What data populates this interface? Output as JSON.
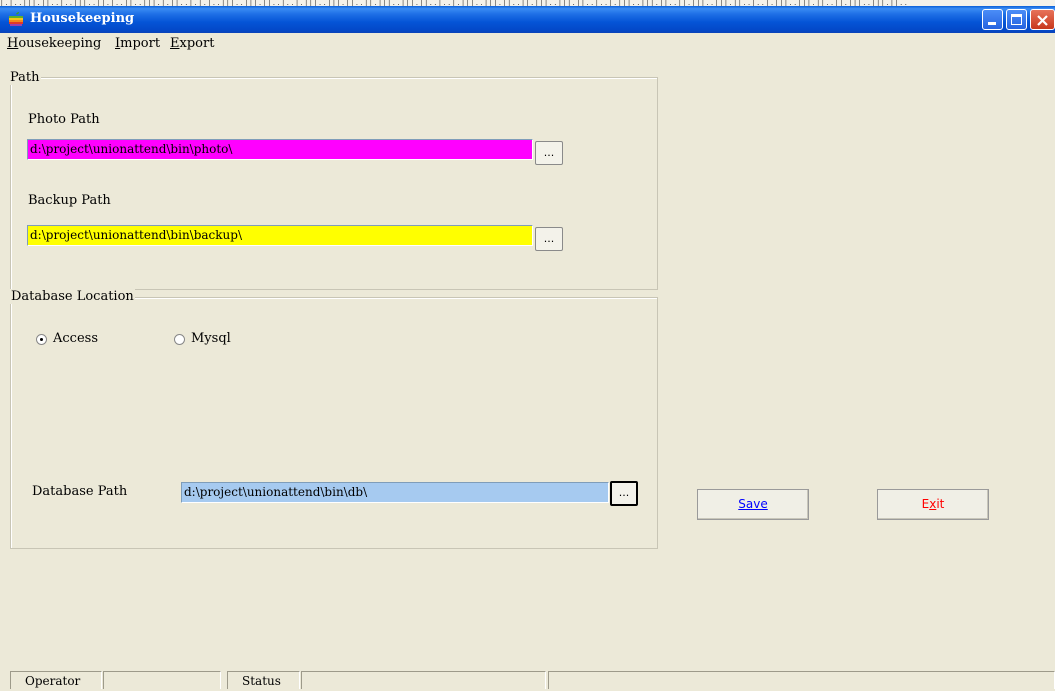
{
  "window": {
    "title": "Housekeeping"
  },
  "menu": [
    {
      "label": "Housekeeping"
    },
    {
      "label": "Import"
    },
    {
      "label": "Export"
    }
  ],
  "path_group": {
    "legend": "Path",
    "photo_label": "Photo Path",
    "photo_value": "d:\\project\\unionattend\\bin\\photo\\",
    "backup_label": "Backup Path",
    "backup_value": "d:\\project\\unionattend\\bin\\backup\\",
    "browse_label": "..."
  },
  "db_group": {
    "legend": "Database Location",
    "radio_access": "Access",
    "radio_mysql": "Mysql",
    "selected": "Access",
    "db_path_label": "Database Path",
    "db_path_value": "d:\\project\\unionattend\\bin\\db\\",
    "browse_label": "..."
  },
  "buttons": {
    "save": "Save",
    "exit": "Exit"
  },
  "status": {
    "operator_label": "Operator",
    "operator_value": "",
    "status_label": "Status",
    "status_value": ""
  },
  "colors": {
    "photo_field_bg": "#ff00ff",
    "backup_field_bg": "#ffff00",
    "db_field_bg": "#a6caf0",
    "save_text": "#0000ff",
    "exit_text": "#ff0000",
    "titlebar": "#0454d6"
  }
}
